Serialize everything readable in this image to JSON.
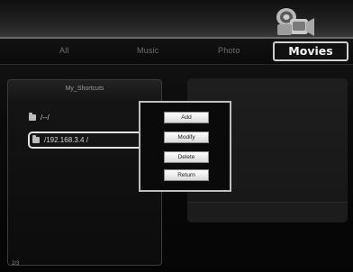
{
  "tabs": {
    "all": "All",
    "music": "Music",
    "photo": "Photo",
    "movies": "Movies"
  },
  "shortcuts": {
    "title": "My_Shortcuts",
    "items": [
      {
        "label": "/--/",
        "icon": "folder-icon"
      },
      {
        "label": "/192.168.3.4 /",
        "icon": "folder-icon"
      }
    ],
    "page": "2/3"
  },
  "popup": {
    "add": "Add",
    "modify": "Modify",
    "delete": "Delete",
    "return": "Return"
  },
  "colors": {
    "background": "#060606",
    "highlight_border": "#e2e2e2",
    "popup_button": "#ffffff"
  }
}
